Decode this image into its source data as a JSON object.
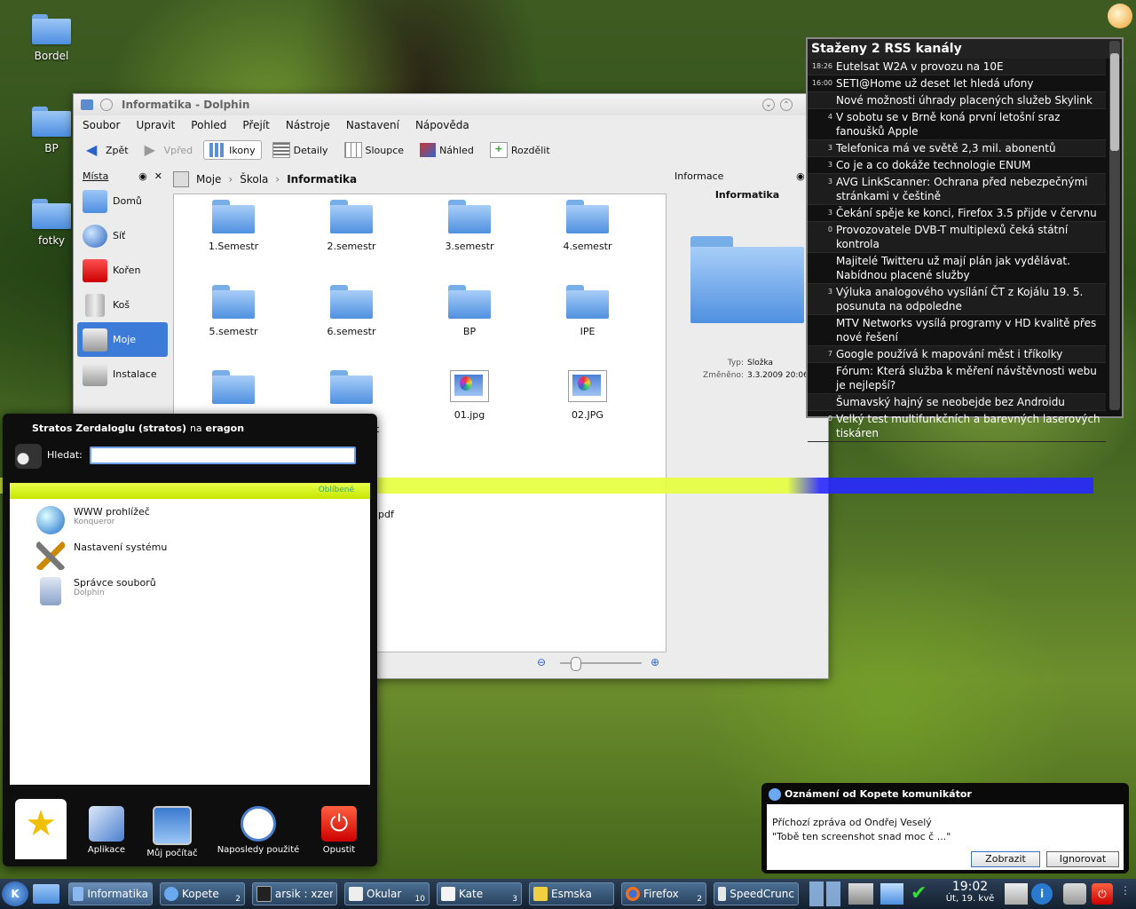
{
  "desktop": {
    "icons": [
      {
        "label": "Bordel"
      },
      {
        "label": "BP"
      },
      {
        "label": "fotky"
      }
    ]
  },
  "dolphin": {
    "title": "Informatika - Dolphin",
    "menu": [
      "Soubor",
      "Upravit",
      "Pohled",
      "Přejít",
      "Nástroje",
      "Nastavení",
      "Nápověda"
    ],
    "toolbar": {
      "back": "Zpět",
      "forward": "Vpřed",
      "icons": "Ikony",
      "details": "Detaily",
      "columns": "Sloupce",
      "preview": "Náhled",
      "split": "Rozdělit"
    },
    "places": {
      "title": "Místa",
      "items": [
        "Domů",
        "Síť",
        "Kořen",
        "Koš",
        "Moje",
        "Instalace"
      ]
    },
    "breadcrumb": [
      "Moje",
      "Škola",
      "Informatika"
    ],
    "files": [
      "1.Semestr",
      "2.semestr",
      "3.semestr",
      "4.semestr",
      "5.semestr",
      "6.semestr",
      "BP",
      "IPE",
      "",
      "",
      "01.jpg",
      "02.JPG"
    ],
    "partial_texts": {
      "t": "t",
      "pdf": "pdf"
    },
    "info": {
      "title": "Informace",
      "name": "Informatika",
      "type_label": "Typ:",
      "type_value": "Složka",
      "modified_label": "Změněno:",
      "modified_value": "3.3.2009 20:06"
    }
  },
  "kickoff": {
    "user_prefix": "Stratos Zerdaloglu (stratos)",
    "user_mid": "na",
    "host": "eragon",
    "search_label": "Hledat:",
    "search_value": "",
    "favorites_label": "Oblíbené",
    "items": [
      {
        "title": "WWW prohlížeč",
        "sub": "Konqueror"
      },
      {
        "title": "Nastavení systému",
        "sub": ""
      },
      {
        "title": "Správce souborů",
        "sub": "Dolphin"
      }
    ],
    "tabs": [
      "",
      "Aplikace",
      "Můj počítač",
      "Naposledy použité",
      "Opustit"
    ]
  },
  "rss": {
    "title": "Staženy 2 RSS kanály",
    "items": [
      {
        "time": "18:26",
        "text": "Eutelsat W2A v provozu na 10E"
      },
      {
        "time": "16:00",
        "text": "SETI@Home už deset let hledá ufony"
      },
      {
        "time": "",
        "text": "Nové možnosti úhrady placených služeb Skylink"
      },
      {
        "time": "4",
        "text": "V sobotu se v Brně koná první letošní sraz fanoušků Apple"
      },
      {
        "time": "3",
        "text": "Telefonica má ve světě 2,3 mil. abonentů"
      },
      {
        "time": "3",
        "text": "Co je a co dokáže technologie ENUM"
      },
      {
        "time": "3",
        "text": "AVG LinkScanner: Ochrana před nebezpečnými stránkami v češtině"
      },
      {
        "time": "3",
        "text": "Čekání spěje ke konci, Firefox 3.5 přijde v červnu"
      },
      {
        "time": "0",
        "text": "Provozovatele DVB-T multiplexů čeká státní kontrola"
      },
      {
        "time": "",
        "text": "Majitelé Twitteru už mají plán jak vydělávat. Nabídnou placené služby"
      },
      {
        "time": "3",
        "text": "Výluka analogového vysílání ČT z Kojálu 19. 5. posunuta na odpoledne"
      },
      {
        "time": "",
        "text": "MTV Networks vysílá programy v HD kvalitě přes nové řešení"
      },
      {
        "time": "7",
        "text": "Google používá k mapování měst i tříkolky"
      },
      {
        "time": "",
        "text": "Fórum: Která služba k měření návštěvnosti webu je nejlepší?"
      },
      {
        "time": "",
        "text": "Šumavský hajný se neobejde bez Androidu"
      },
      {
        "time": "0",
        "text": "Velký test multifunkčních a barevných laserových tiskáren"
      }
    ]
  },
  "notification": {
    "title": "Oznámení od Kopete komunikátor",
    "line1": "Příchozí zpráva od Ondřej Veselý",
    "line2": "\"Tobě ten screenshot snad moc č ...\"",
    "show": "Zobrazit",
    "ignore": "Ignorovat"
  },
  "taskbar": {
    "tasks": [
      {
        "label": "Informatika",
        "count": ""
      },
      {
        "label": "Kopete",
        "count": "2"
      },
      {
        "label": "arsik : xzer",
        "count": ""
      },
      {
        "label": "Okular",
        "count": "10"
      },
      {
        "label": "Kate",
        "count": "3"
      },
      {
        "label": "Esmska",
        "count": ""
      },
      {
        "label": "Firefox",
        "count": "2"
      },
      {
        "label": "SpeedCrunc",
        "count": ""
      }
    ],
    "clock_time": "19:02",
    "clock_date": "Út, 19. kvě"
  }
}
